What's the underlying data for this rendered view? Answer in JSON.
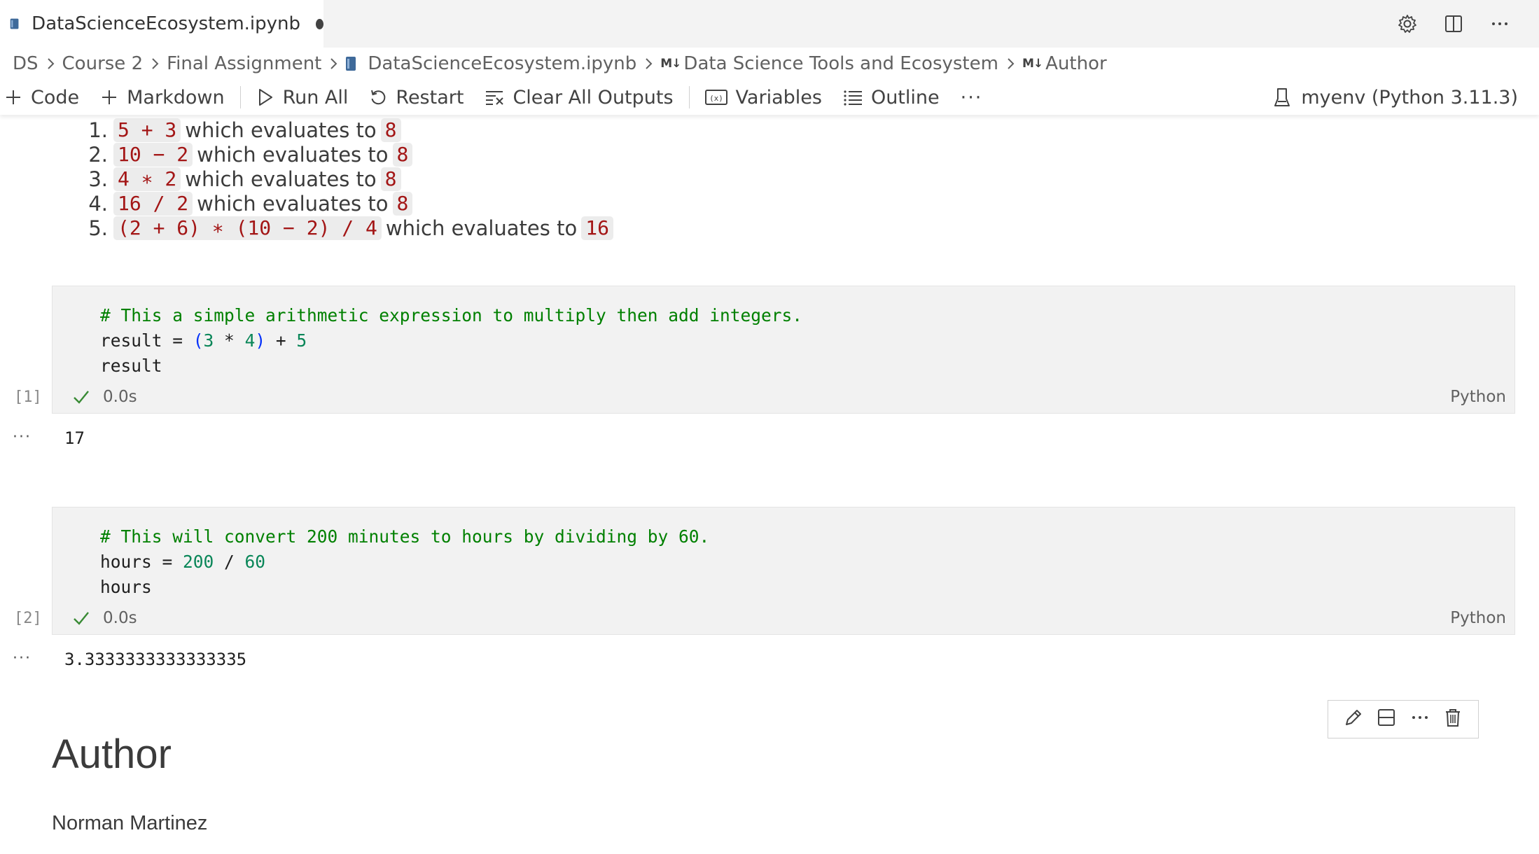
{
  "tab": {
    "title": "DataScienceEcosystem.ipynb"
  },
  "breadcrumb": {
    "items": [
      "DS",
      "Course 2",
      "Final Assignment",
      "DataScienceEcosystem.ipynb"
    ],
    "md_badge": "M↓",
    "md_items": [
      "Data Science Tools and Ecosystem",
      "Author"
    ]
  },
  "toolbar": {
    "code": "Code",
    "markdown": "Markdown",
    "run_all": "Run All",
    "restart": "Restart",
    "clear_outputs": "Clear All Outputs",
    "variables": "Variables",
    "outline": "Outline",
    "more": "···",
    "kernel": "myenv (Python 3.11.3)"
  },
  "md_list": {
    "connector": "which evaluates to",
    "items": [
      {
        "num": "1.",
        "expr": "5 + 3",
        "result": "8"
      },
      {
        "num": "2.",
        "expr": "10 − 2",
        "result": "8"
      },
      {
        "num": "3.",
        "expr": "4 ∗ 2",
        "result": "8"
      },
      {
        "num": "4.",
        "expr": "16 / 2",
        "result": "8"
      },
      {
        "num": "5.",
        "expr": "(2 + 6) ∗ (10 − 2) / 4",
        "result": "16"
      }
    ]
  },
  "cells": [
    {
      "comment": "# This a simple arithmetic expression to multiply then add integers.",
      "line2": {
        "var": "result = ",
        "lp": "(",
        "n1": "3",
        "op1": " * ",
        "n2": "4",
        "rp": ")",
        "op2": " + ",
        "n3": "5"
      },
      "line3": "result",
      "exec_count": "[1]",
      "duration": "0.0s",
      "language": "Python",
      "output": "17"
    },
    {
      "comment": "# This will convert 200 minutes to hours by dividing by 60.",
      "line2": {
        "var": "hours = ",
        "n1": "200",
        "op1": " / ",
        "n2": "60"
      },
      "line3": "hours",
      "exec_count": "[2]",
      "duration": "0.0s",
      "language": "Python",
      "output": "3.3333333333333335"
    }
  ],
  "output_menu": "···",
  "author": {
    "heading": "Author",
    "name": "Norman Martinez"
  },
  "colors": {
    "code_red": "#a31515",
    "comment_green": "#008000",
    "number_green": "#098658",
    "paren_blue": "#0431fa",
    "check_green": "#388a34"
  }
}
